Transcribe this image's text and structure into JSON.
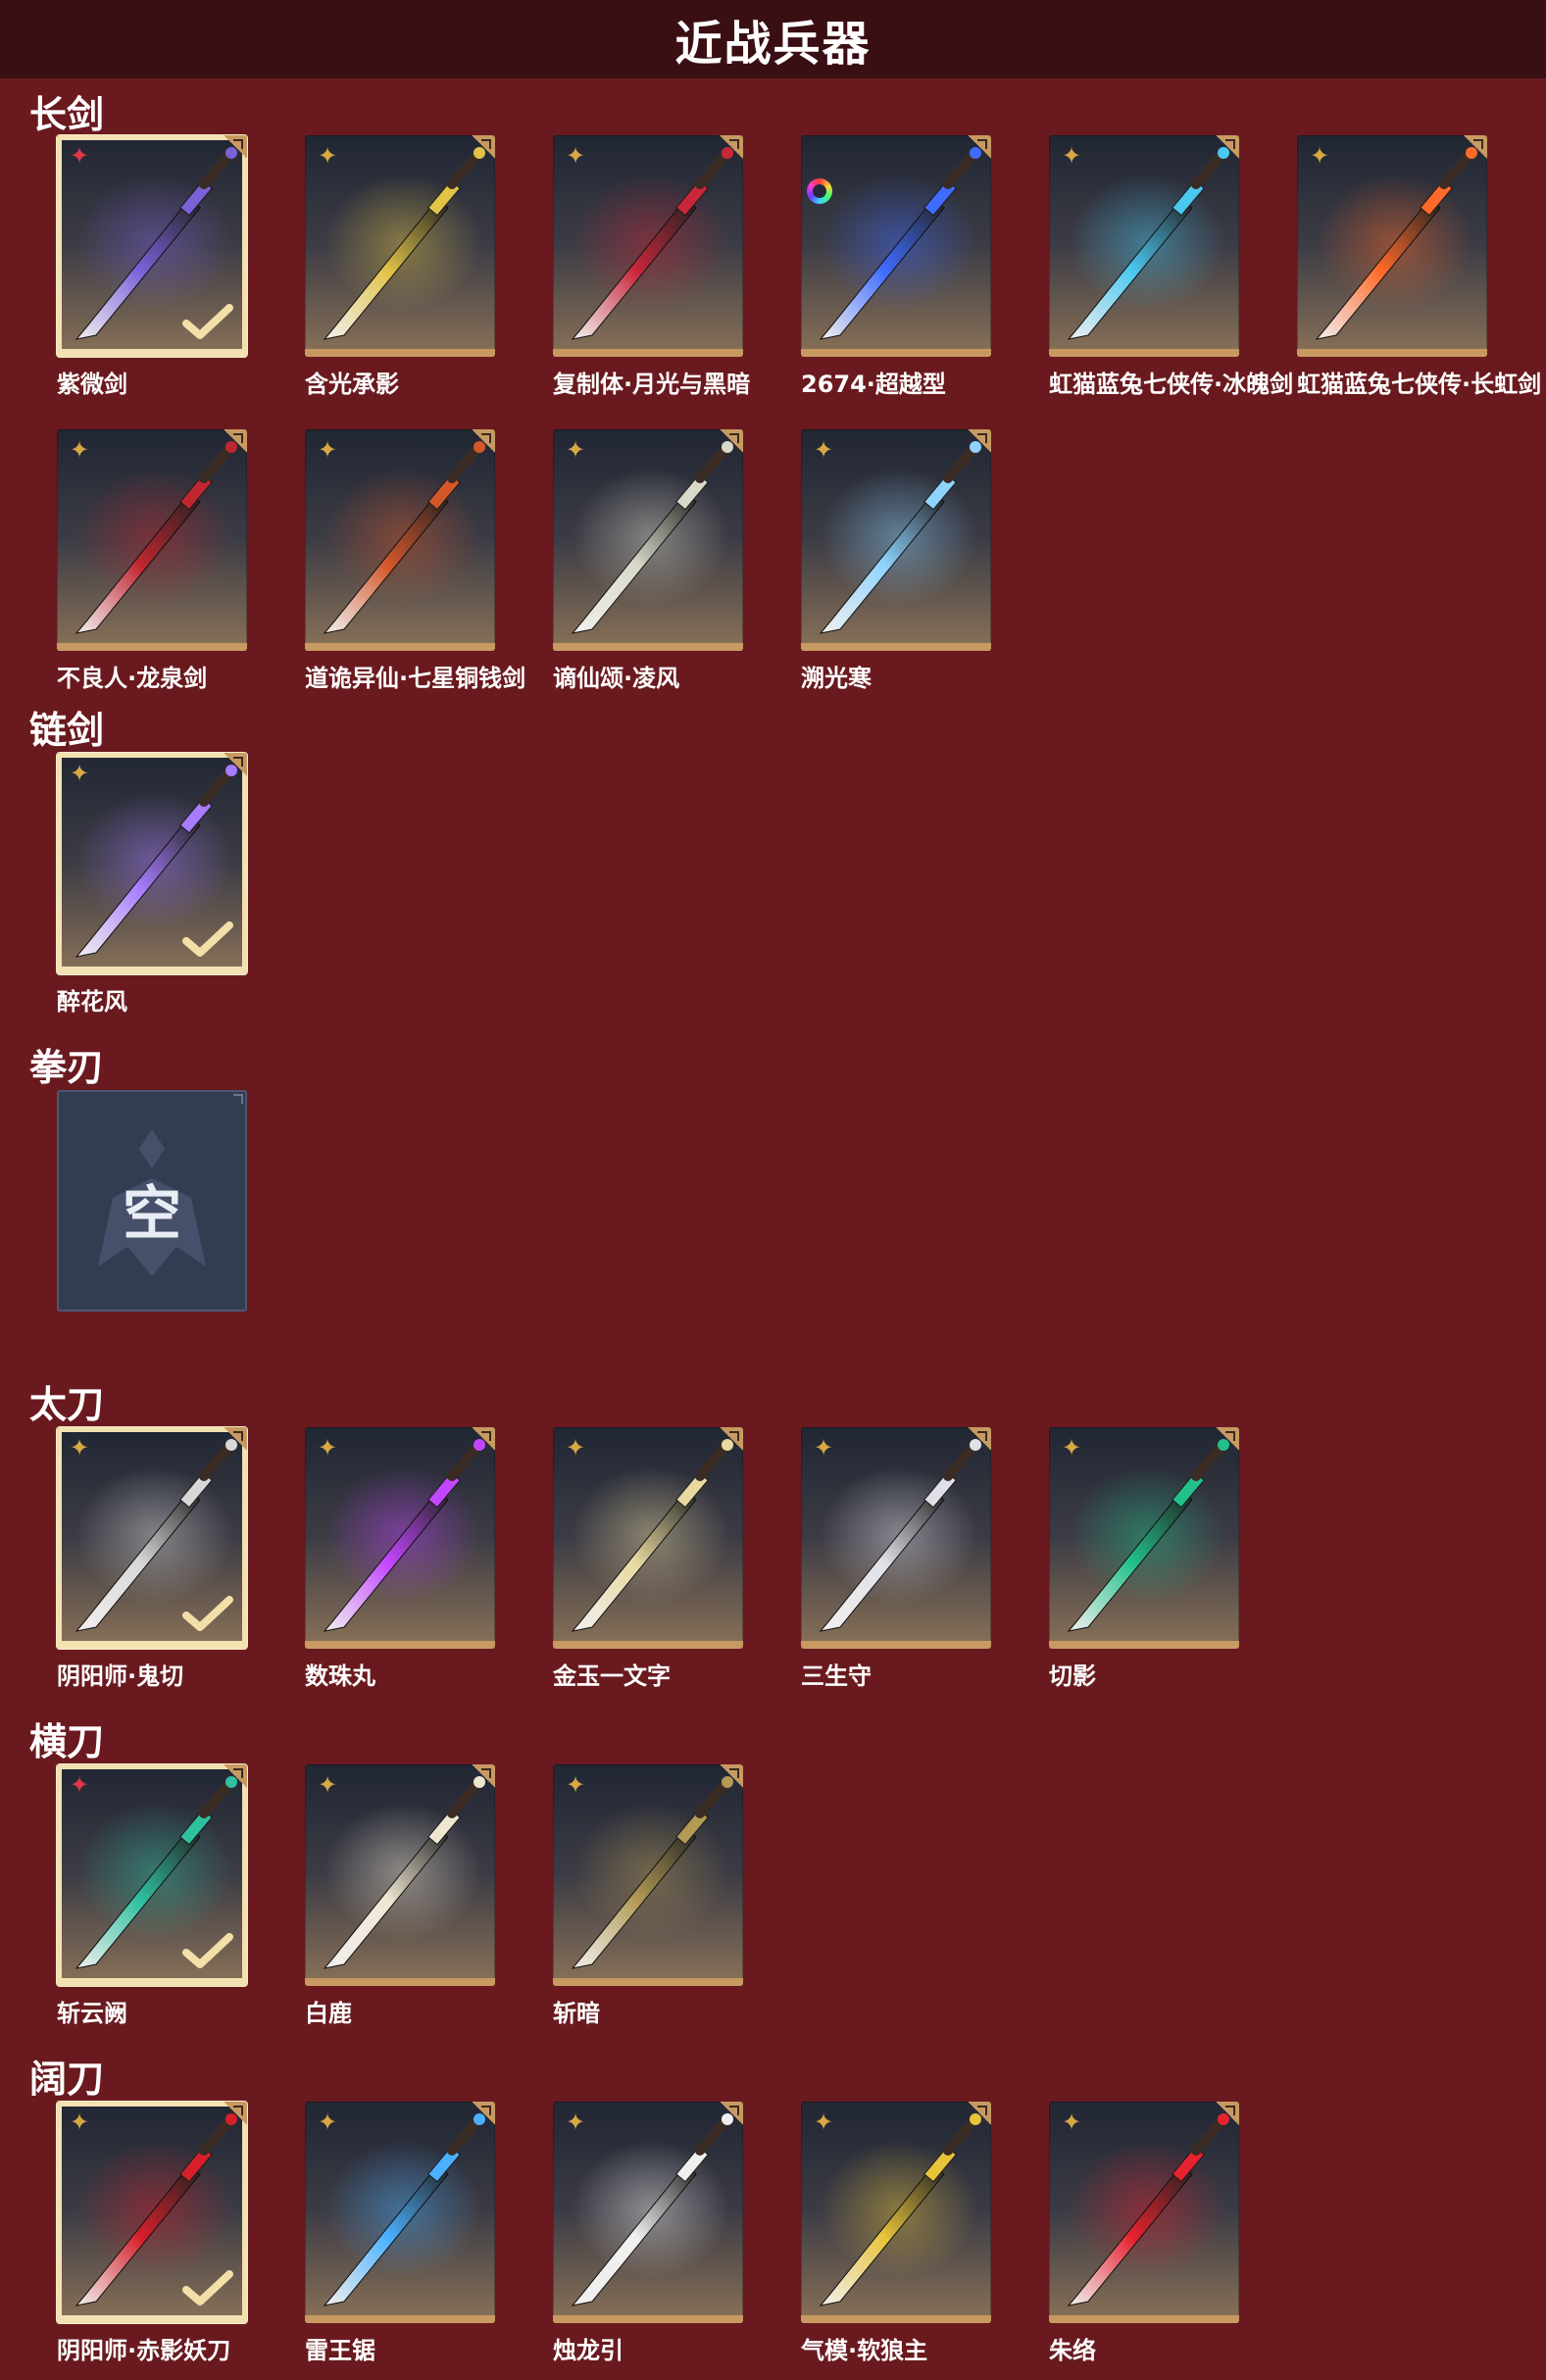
{
  "header": {
    "title": "近战兵器"
  },
  "sections": [
    {
      "title": "长剑",
      "items": [
        {
          "name": "紫微剑",
          "rarity": "red",
          "selected": true,
          "color": "#7b61d8"
        },
        {
          "name": "含光承影",
          "rarity": "gold",
          "selected": false,
          "color": "#e0c347"
        },
        {
          "name": "复制体·月光与黑暗",
          "rarity": "gold",
          "selected": false,
          "color": "#c8273a"
        },
        {
          "name": "2674·超越型",
          "rarity": "rainbow",
          "selected": false,
          "color": "#3f6cff"
        },
        {
          "name": "虹猫蓝兔七侠传·冰魄剑",
          "rarity": "gold",
          "selected": false,
          "color": "#4bc8f0"
        },
        {
          "name": "虹猫蓝兔七侠传·长虹剑",
          "rarity": "gold",
          "selected": false,
          "color": "#ff6a2a"
        },
        {
          "name": "不良人·龙泉剑",
          "rarity": "gold",
          "selected": false,
          "color": "#c0262f"
        },
        {
          "name": "道诡异仙·七星铜钱剑",
          "rarity": "gold",
          "selected": false,
          "color": "#d4572a"
        },
        {
          "name": "谪仙颂·凌风",
          "rarity": "gold",
          "selected": false,
          "color": "#d9d9c9"
        },
        {
          "name": "溯光寒",
          "rarity": "gold",
          "selected": false,
          "color": "#8fd4ff"
        }
      ]
    },
    {
      "title": "链剑",
      "items": [
        {
          "name": "醉花风",
          "rarity": "gold",
          "selected": true,
          "color": "#a77cff"
        }
      ]
    },
    {
      "title": "拳刃",
      "empty_label": "空",
      "items": []
    },
    {
      "title": "太刀",
      "items": [
        {
          "name": "阴阳师·鬼切",
          "rarity": "gold",
          "selected": true,
          "color": "#d8d8d8"
        },
        {
          "name": "数珠丸",
          "rarity": "gold",
          "selected": false,
          "color": "#c346ff"
        },
        {
          "name": "金玉一文字",
          "rarity": "gold",
          "selected": false,
          "color": "#e8d9a0"
        },
        {
          "name": "三生守",
          "rarity": "gold",
          "selected": false,
          "color": "#e0e0e8"
        },
        {
          "name": "切影",
          "rarity": "gold",
          "selected": false,
          "color": "#22c08a"
        }
      ]
    },
    {
      "title": "横刀",
      "items": [
        {
          "name": "斩云阙",
          "rarity": "red",
          "selected": true,
          "color": "#2fc0a0"
        },
        {
          "name": "白鹿",
          "rarity": "gold",
          "selected": false,
          "color": "#efe6d2"
        },
        {
          "name": "斩暗",
          "rarity": "gold",
          "selected": false,
          "color": "#b39a55"
        }
      ]
    },
    {
      "title": "阔刀",
      "items": [
        {
          "name": "阴阳师·赤影妖刀",
          "rarity": "gold",
          "selected": true,
          "color": "#d61f2a"
        },
        {
          "name": "雷王锯",
          "rarity": "gold",
          "selected": false,
          "color": "#4bb0ff"
        },
        {
          "name": "烛龙引",
          "rarity": "gold",
          "selected": false,
          "color": "#efefef"
        },
        {
          "name": "气模·软狼主",
          "rarity": "gold",
          "selected": false,
          "color": "#e8c43a"
        },
        {
          "name": "朱络",
          "rarity": "gold",
          "selected": false,
          "color": "#e5222e"
        }
      ]
    }
  ]
}
